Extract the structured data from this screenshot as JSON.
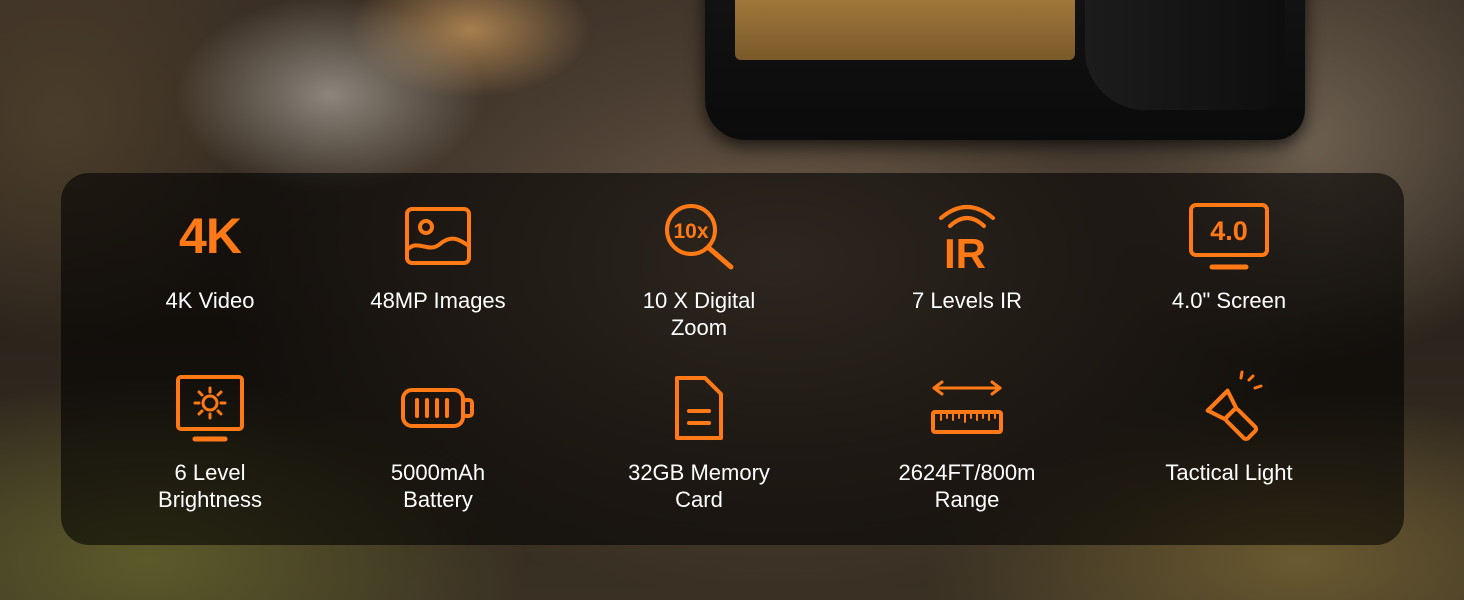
{
  "accent_color": "#ff7a16",
  "features": [
    {
      "icon": "4k-text-icon",
      "icon_text": "4K",
      "label": "4K Video"
    },
    {
      "icon": "image-icon",
      "label": "48MP Images"
    },
    {
      "icon": "zoom-magnifier-icon",
      "icon_text": "10x",
      "label": "10 X Digital\nZoom"
    },
    {
      "icon": "infrared-signal-icon",
      "icon_text": "IR",
      "label": "7 Levels IR"
    },
    {
      "icon": "monitor-screen-icon",
      "icon_text": "4.0",
      "label": "4.0\" Screen"
    },
    {
      "icon": "brightness-monitor-icon",
      "label": "6 Level\nBrightness"
    },
    {
      "icon": "battery-icon",
      "label": "5000mAh\nBattery"
    },
    {
      "icon": "memory-card-icon",
      "label": "32GB Memory\nCard"
    },
    {
      "icon": "range-ruler-icon",
      "label": "2624FT/800m\nRange"
    },
    {
      "icon": "flashlight-icon",
      "label": "Tactical Light"
    }
  ]
}
